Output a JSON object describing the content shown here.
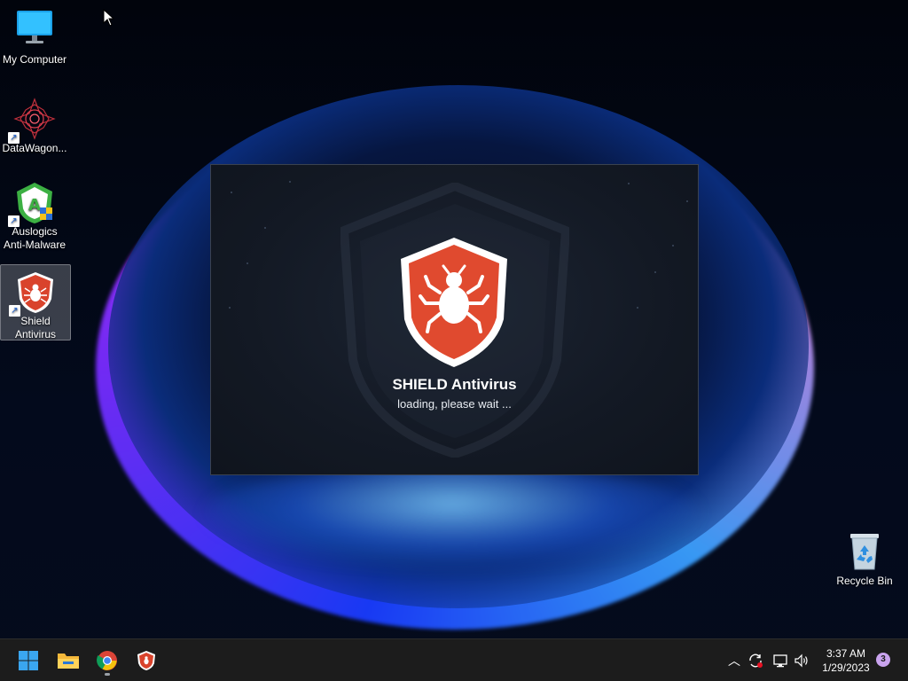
{
  "desktop": {
    "icons": [
      {
        "label": "My Computer",
        "icon": "monitor-icon"
      },
      {
        "label": "DataWagon...",
        "icon": "datawagon-icon"
      },
      {
        "label": "Auslogics Anti-Malware",
        "icon": "auslogics-shield-icon"
      },
      {
        "label": "Shield Antivirus",
        "icon": "shield-antivirus-icon"
      },
      {
        "label": "Recycle Bin",
        "icon": "recycle-bin-icon"
      }
    ]
  },
  "splash": {
    "title": "SHIELD Antivirus",
    "status": "loading, please wait ...",
    "accent_color": "#e04a2f"
  },
  "taskbar": {
    "buttons": [
      {
        "name": "start",
        "icon": "windows-start-icon"
      },
      {
        "name": "file-explorer",
        "icon": "folder-icon"
      },
      {
        "name": "chrome",
        "icon": "chrome-icon"
      },
      {
        "name": "shield-antivirus",
        "icon": "shield-antivirus-icon"
      }
    ],
    "tray": {
      "icons": [
        "chevron-up-icon",
        "sync-icon",
        "network-icon",
        "speaker-icon"
      ],
      "time": "3:37 AM",
      "date": "1/29/2023",
      "notification_count": "3"
    }
  }
}
